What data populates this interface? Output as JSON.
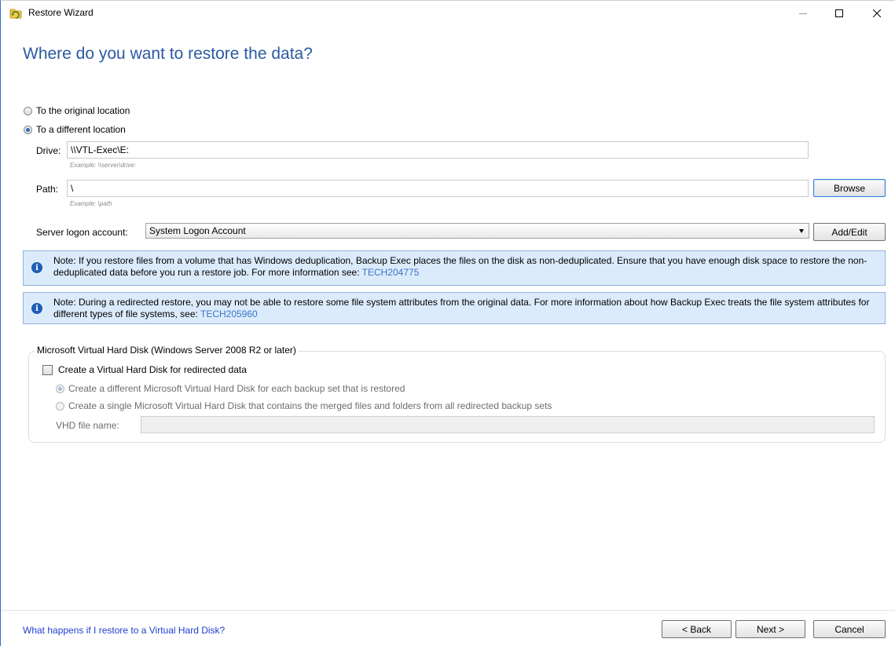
{
  "window": {
    "title": "Restore Wizard",
    "controls": [
      "minimize",
      "maximize",
      "close"
    ]
  },
  "heading": "Where do you want to restore the data?",
  "location": {
    "original_label": "To the original location",
    "different_label": "To a different location",
    "selected": "different"
  },
  "drive": {
    "label": "Drive:",
    "value": "\\\\VTL-Exec\\E:",
    "example": "Example: \\\\server\\drive:"
  },
  "path": {
    "label": "Path:",
    "value": "\\",
    "example": "Example: \\path",
    "browse_label": "Browse"
  },
  "logon": {
    "label": "Server logon account:",
    "selected": "System Logon Account",
    "add_edit_label": "Add/Edit"
  },
  "notes": [
    {
      "text": "Note: If you restore files from a volume that has Windows deduplication, Backup Exec places the files on the disk as non-deduplicated. Ensure that you have enough disk space to restore the non-deduplicated data before you run a restore job. For more information see: ",
      "link": "TECH204775"
    },
    {
      "text": "Note: During a redirected restore, you may not be able to restore some file system attributes from the original data. For more information about how Backup Exec treats the file system attributes for different types of file systems, see: ",
      "link": "TECH205960"
    }
  ],
  "vhd": {
    "group_title": "Microsoft Virtual Hard Disk (Windows Server 2008 R2 or later)",
    "create_label": "Create a Virtual Hard Disk for redirected data",
    "create_checked": false,
    "option_each": "Create a different Microsoft Virtual Hard Disk for each backup set that is restored",
    "option_single": "Create a single Microsoft Virtual Hard Disk that contains the merged files and folders from all redirected backup sets",
    "filename_label": "VHD file name:",
    "filename_value": ""
  },
  "footer": {
    "help_link": "What happens if I restore to a Virtual Hard Disk?",
    "back_label": "< Back",
    "next_label": "Next >",
    "cancel_label": "Cancel"
  },
  "colors": {
    "heading": "#2a5aa0",
    "note_background": "#dcebfb",
    "link": "#3a74c8"
  }
}
